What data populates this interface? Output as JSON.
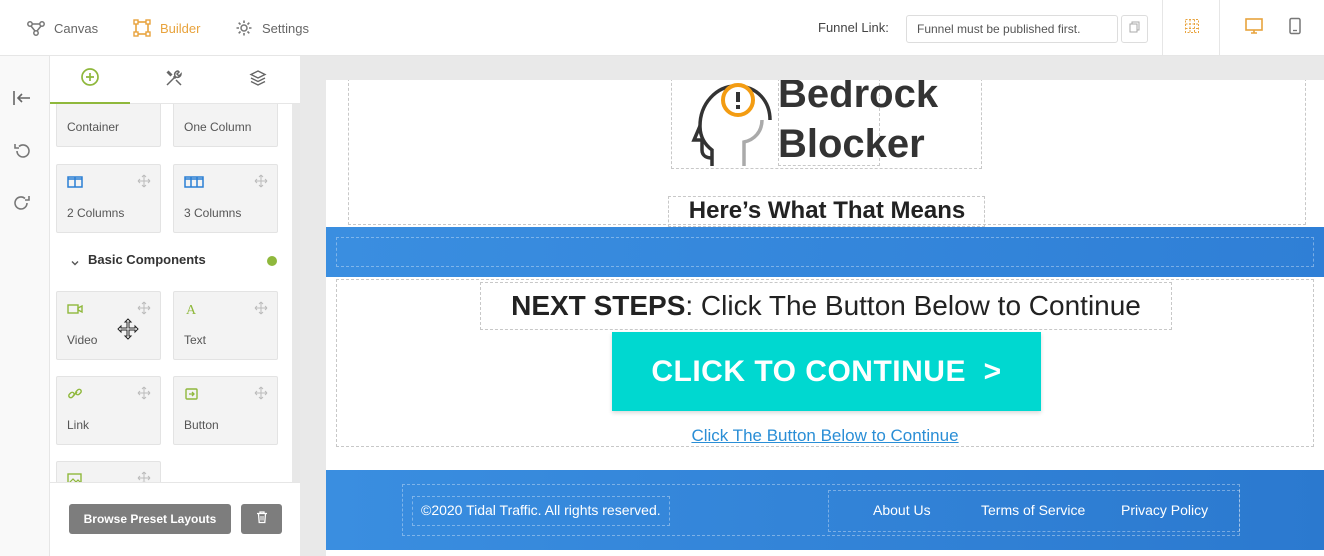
{
  "topbar": {
    "nav": [
      {
        "label": "Canvas",
        "icon": "canvas-icon"
      },
      {
        "label": "Builder",
        "icon": "builder-icon",
        "active": true
      },
      {
        "label": "Settings",
        "icon": "gear-icon"
      }
    ],
    "funnel_link_label": "Funnel Link:",
    "funnel_link_value": "Funnel must be published first.",
    "colors": {
      "accent": "#e8a33d"
    }
  },
  "panel": {
    "layout_items": [
      {
        "label": "Container"
      },
      {
        "label": "One Column"
      },
      {
        "label": "2 Columns",
        "icon": "two-columns-icon"
      },
      {
        "label": "3 Columns",
        "icon": "three-columns-icon"
      }
    ],
    "section_title": "Basic Components",
    "components": [
      {
        "label": "Video",
        "icon": "video-icon"
      },
      {
        "label": "Text",
        "icon": "text-icon"
      },
      {
        "label": "Link",
        "icon": "link-icon"
      },
      {
        "label": "Button",
        "icon": "button-icon"
      }
    ],
    "browse_label": "Browse Preset Layouts",
    "colors": {
      "tab_active": "#8fb83c"
    }
  },
  "page": {
    "logo_line1": "Bedrock",
    "logo_line2": "Blocker",
    "heading": "Here’s What That Means",
    "next_steps_bold": "NEXT STEPS",
    "next_steps_rest": ": Click The Button Below to Continue",
    "cta_label": "CLICK TO CONTINUE  >",
    "cta_link": "Click The Button Below to Continue",
    "footer": {
      "copyright": "©2020 Tidal Traffic. All rights reserved.",
      "links": [
        "About Us",
        "Terms of Service",
        "Privacy Policy"
      ]
    },
    "colors": {
      "band": "#3a8ee0",
      "cta": "#00d8d0",
      "link": "#2a8ed6"
    }
  }
}
